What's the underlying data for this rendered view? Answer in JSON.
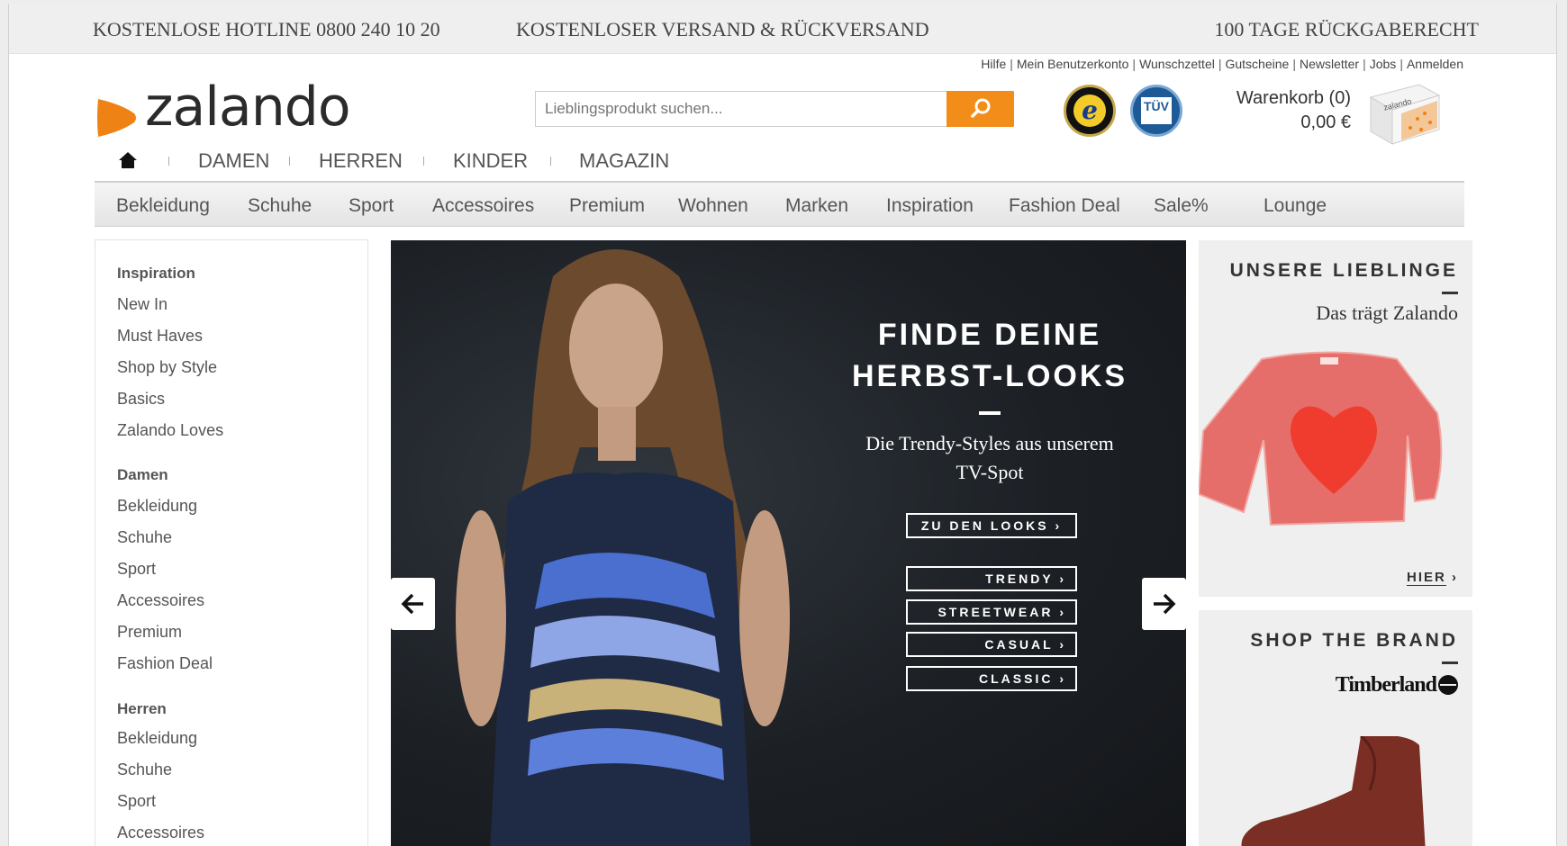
{
  "topbar": {
    "hotline": "KOSTENLOSE HOTLINE 0800 240 10 20",
    "shipping": "KOSTENLOSER VERSAND & RÜCKVERSAND",
    "returns": "100 TAGE RÜCKGABERECHT"
  },
  "utility_links": [
    "Hilfe",
    "Mein Benutzerkonto",
    "Wunschzettel",
    "Gutscheine",
    "Newsletter",
    "Jobs",
    "Anmelden"
  ],
  "logo": {
    "text": "zalando",
    "color": "#ef8214"
  },
  "search": {
    "placeholder": "Lieblingsprodukt suchen...",
    "button_color": "#f28d1a",
    "icon": "search-icon"
  },
  "cart": {
    "label": "Warenkorb (0)",
    "total": "0,00 €",
    "box_text": "zalando"
  },
  "gender_nav": {
    "home_icon": "home-icon",
    "items": [
      "DAMEN",
      "HERREN",
      "KINDER",
      "MAGAZIN"
    ]
  },
  "categories": [
    "Bekleidung",
    "Schuhe",
    "Sport",
    "Accessoires",
    "Premium",
    "Wohnen",
    "Marken",
    "Inspiration",
    "Fashion Deal",
    "Sale%",
    "Lounge"
  ],
  "sidebar": {
    "sections": [
      {
        "title": "Inspiration",
        "links": [
          "New In",
          "Must Haves",
          "Shop by Style",
          "Basics",
          "Zalando Loves"
        ]
      },
      {
        "title": "Damen",
        "links": [
          "Bekleidung",
          "Schuhe",
          "Sport",
          "Accessoires",
          "Premium",
          "Fashion Deal"
        ]
      },
      {
        "title": "Herren",
        "links": [
          "Bekleidung",
          "Schuhe",
          "Sport",
          "Accessoires"
        ]
      }
    ]
  },
  "hero": {
    "title_line1": "FINDE DEINE",
    "title_line2": "HERBST-LOOKS",
    "subtitle": "Die Trendy-Styles aus unserem TV-Spot",
    "cta": "ZU DEN LOOKS ›",
    "buttons": [
      "TRENDY ›",
      "STREETWEAR ›",
      "CASUAL ›",
      "CLASSIC ›"
    ]
  },
  "cards": {
    "favorites": {
      "heading": "UNSERE LIEBLINGE",
      "subtitle": "Das trägt Zalando",
      "link": "HIER",
      "link_arrow": "›"
    },
    "brand": {
      "heading": "SHOP THE BRAND",
      "brand_name": "Timberland"
    }
  }
}
